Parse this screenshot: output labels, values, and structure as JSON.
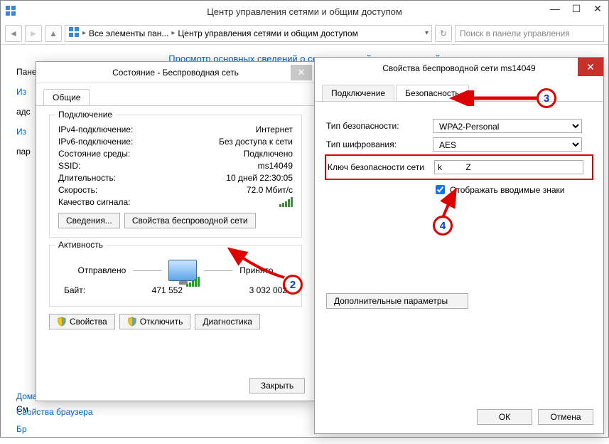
{
  "main": {
    "title": "Центр управления сетями и общим доступом",
    "nav": {
      "crumb1": "Все элементы пан...",
      "crumb2": "Центр управления сетями и общим доступом",
      "search_placeholder": "Поиск в панели управления"
    },
    "heading": "Просмотр основных сведений о сети и настройка подключений",
    "truncated": {
      "a": "Пане",
      "b": "Из",
      "c": "адс",
      "d": "Из",
      "e": "пар",
      "f": "См",
      "g": "Бр"
    },
    "links": {
      "homegroup": "Домашняя группа",
      "browser": "Свойства браузера"
    }
  },
  "status_dialog": {
    "title": "Состояние - Беспроводная сеть",
    "tab_general": "Общие",
    "group_connection": {
      "legend": "Подключение",
      "rows": {
        "ipv4_label": "IPv4-подключение:",
        "ipv4_value": "Интернет",
        "ipv6_label": "IPv6-подключение:",
        "ipv6_value": "Без доступа к сети",
        "media_label": "Состояние среды:",
        "media_value": "Подключено",
        "ssid_label": "SSID:",
        "ssid_value": "ms14049",
        "duration_label": "Длительность:",
        "duration_value": "10 дней 22:30:05",
        "speed_label": "Скорость:",
        "speed_value": "72.0 Мбит/с",
        "signal_label": "Качество сигнала:"
      },
      "btn_details": "Сведения...",
      "btn_wprops": "Свойства беспроводной сети"
    },
    "group_activity": {
      "legend": "Активность",
      "sent": "Отправлено",
      "received": "Принято",
      "bytes_label": "Байт:",
      "bytes_sent": "471 552",
      "bytes_recv": "3 032 002"
    },
    "btn_properties": "Свойства",
    "btn_disconnect": "Отключить",
    "btn_diagnose": "Диагностика",
    "btn_close": "Закрыть"
  },
  "props_dialog": {
    "title": "Свойства беспроводной сети ms14049",
    "tab_connection": "Подключение",
    "tab_security": "Безопасность",
    "lbl_sectype": "Тип безопасности:",
    "val_sectype": "WPA2-Personal",
    "lbl_enc": "Тип шифрования:",
    "val_enc": "AES",
    "lbl_key": "Ключ безопасности сети",
    "val_key": "k          Z",
    "chk_show": "Отображать вводимые знаки",
    "btn_advanced": "Дополнительные параметры",
    "btn_ok": "ОК",
    "btn_cancel": "Отмена"
  },
  "annot": {
    "2": "2",
    "3": "3",
    "4": "4"
  }
}
